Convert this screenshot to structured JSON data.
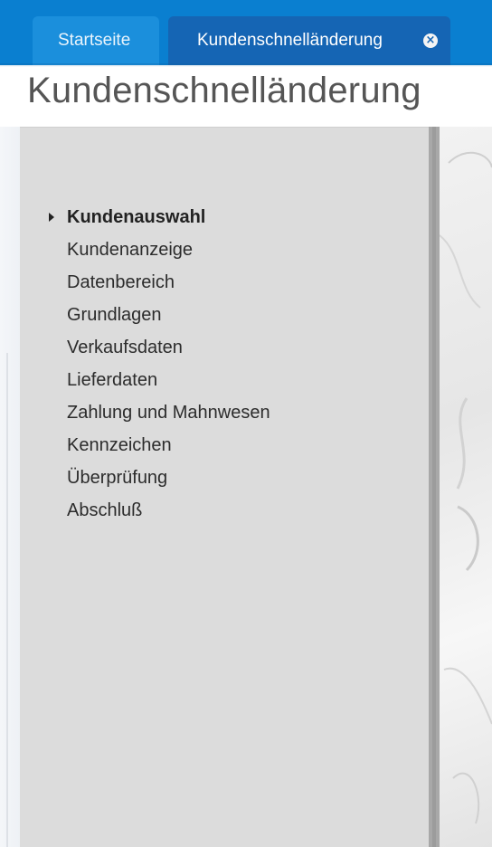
{
  "tabs": [
    {
      "label": "Startseite",
      "active": false
    },
    {
      "label": "Kundenschnelländerung",
      "active": true,
      "close_icon": "close-icon"
    }
  ],
  "page": {
    "title": "Kundenschnelländerung"
  },
  "nav": {
    "active_index": 0,
    "active_indicator_icon": "triangle-right-icon",
    "items": [
      {
        "label": "Kundenauswahl"
      },
      {
        "label": "Kundenanzeige"
      },
      {
        "label": "Datenbereich"
      },
      {
        "label": "Grundlagen"
      },
      {
        "label": "Verkaufsdaten"
      },
      {
        "label": "Lieferdaten"
      },
      {
        "label": "Zahlung und Mahnwesen"
      },
      {
        "label": "Kennzeichen"
      },
      {
        "label": "Überprüfung"
      },
      {
        "label": "Abschluß"
      }
    ]
  },
  "colors": {
    "tabbar": "#0a7fd0",
    "tab_active": "#1565b4",
    "tab_inactive": "#1b8fdc",
    "panel": "#dcdcdc",
    "panel_border": "#a8a8a8",
    "title_text": "#555555"
  }
}
